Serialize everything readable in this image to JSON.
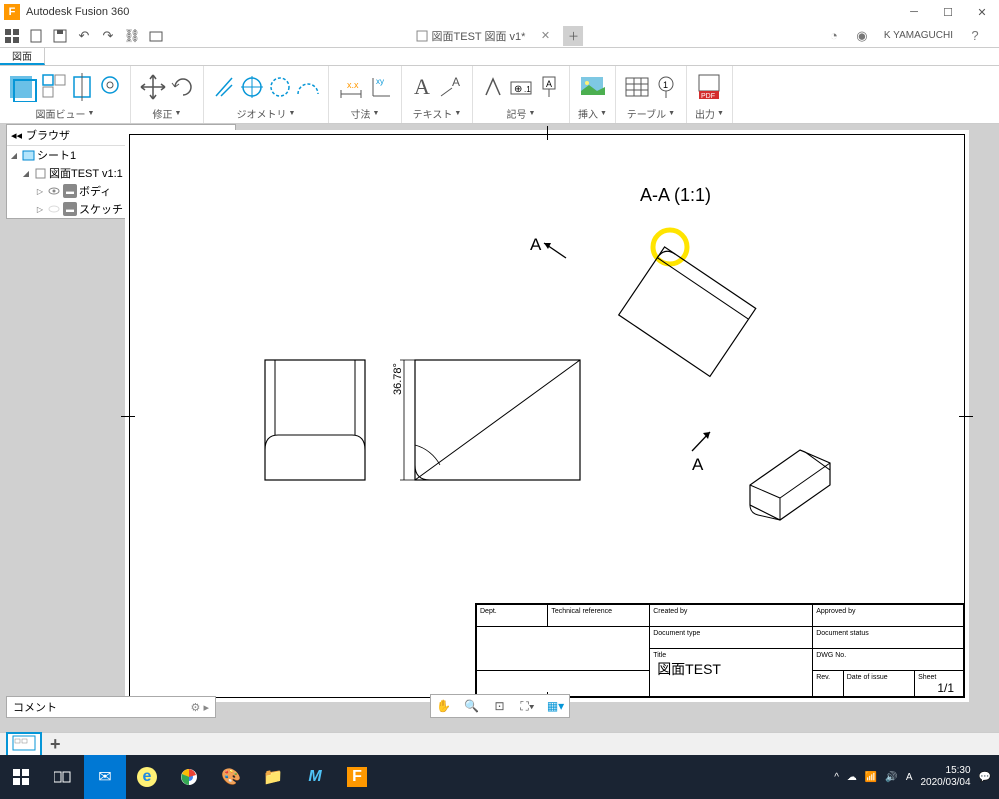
{
  "app": {
    "title": "Autodesk Fusion 360",
    "logo_letter": "F"
  },
  "qat": {
    "user": "K YAMAGUCHI",
    "doc_tab": "図面TEST 図面 v1*"
  },
  "workspace_tab": "図面",
  "ribbon": {
    "groups": [
      {
        "id": "view",
        "label": "図面ビュー"
      },
      {
        "id": "modify",
        "label": "修正"
      },
      {
        "id": "geometry",
        "label": "ジオメトリ"
      },
      {
        "id": "dimension",
        "label": "寸法"
      },
      {
        "id": "text",
        "label": "テキスト"
      },
      {
        "id": "symbol",
        "label": "記号"
      },
      {
        "id": "insert",
        "label": "挿入"
      },
      {
        "id": "table",
        "label": "テーブル"
      },
      {
        "id": "output",
        "label": "出力"
      }
    ],
    "pdf": "PDF"
  },
  "browser": {
    "title": "ブラウザ",
    "nodes": {
      "sheet": "シート1",
      "doc": "図面TEST v1:1",
      "body": "ボディ",
      "sketch": "スケッチ"
    }
  },
  "drawing": {
    "section_title": "A-A (1:1)",
    "section_mark_a": "A",
    "section_mark_b": "A",
    "angle_dim": "36.78°"
  },
  "titleblock": {
    "dept": "Dept.",
    "techref": "Technical reference",
    "created": "Created by",
    "approved": "Approved by",
    "doctype": "Document type",
    "docstatus": "Document status",
    "title_l": "Title",
    "title_v": "図面TEST",
    "dwgno": "DWG No.",
    "rev": "Rev.",
    "doi": "Date of issue",
    "sheet_l": "Sheet",
    "sheet_v": "1/1"
  },
  "comment_panel": "コメント",
  "taskbar": {
    "ime": "A",
    "time": "15:30",
    "date": "2020/03/04"
  }
}
